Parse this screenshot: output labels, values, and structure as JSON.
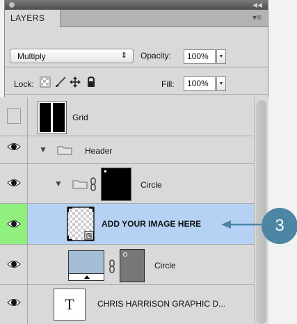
{
  "panel": {
    "tab_label": "LAYERS"
  },
  "blend": {
    "mode": "Multiply",
    "opacity_label": "Opacity:",
    "opacity_value": "100%"
  },
  "lock": {
    "label": "Lock:",
    "fill_label": "Fill:",
    "fill_value": "100%"
  },
  "layers": [
    {
      "name": "Grid",
      "visible": false
    },
    {
      "name": "Header",
      "visible": true
    },
    {
      "name": "Circle",
      "visible": true
    },
    {
      "name": "ADD YOUR IMAGE HERE",
      "visible": true,
      "selected": true
    },
    {
      "name": "Circle",
      "visible": true
    },
    {
      "name": "CHRIS HARRISON GRAPHIC D...",
      "visible": true
    }
  ],
  "callout": {
    "number": "3"
  },
  "colors": {
    "selected_row": "#b5d2f5",
    "selected_eye": "#8ff07e",
    "callout": "#4c86a4"
  }
}
